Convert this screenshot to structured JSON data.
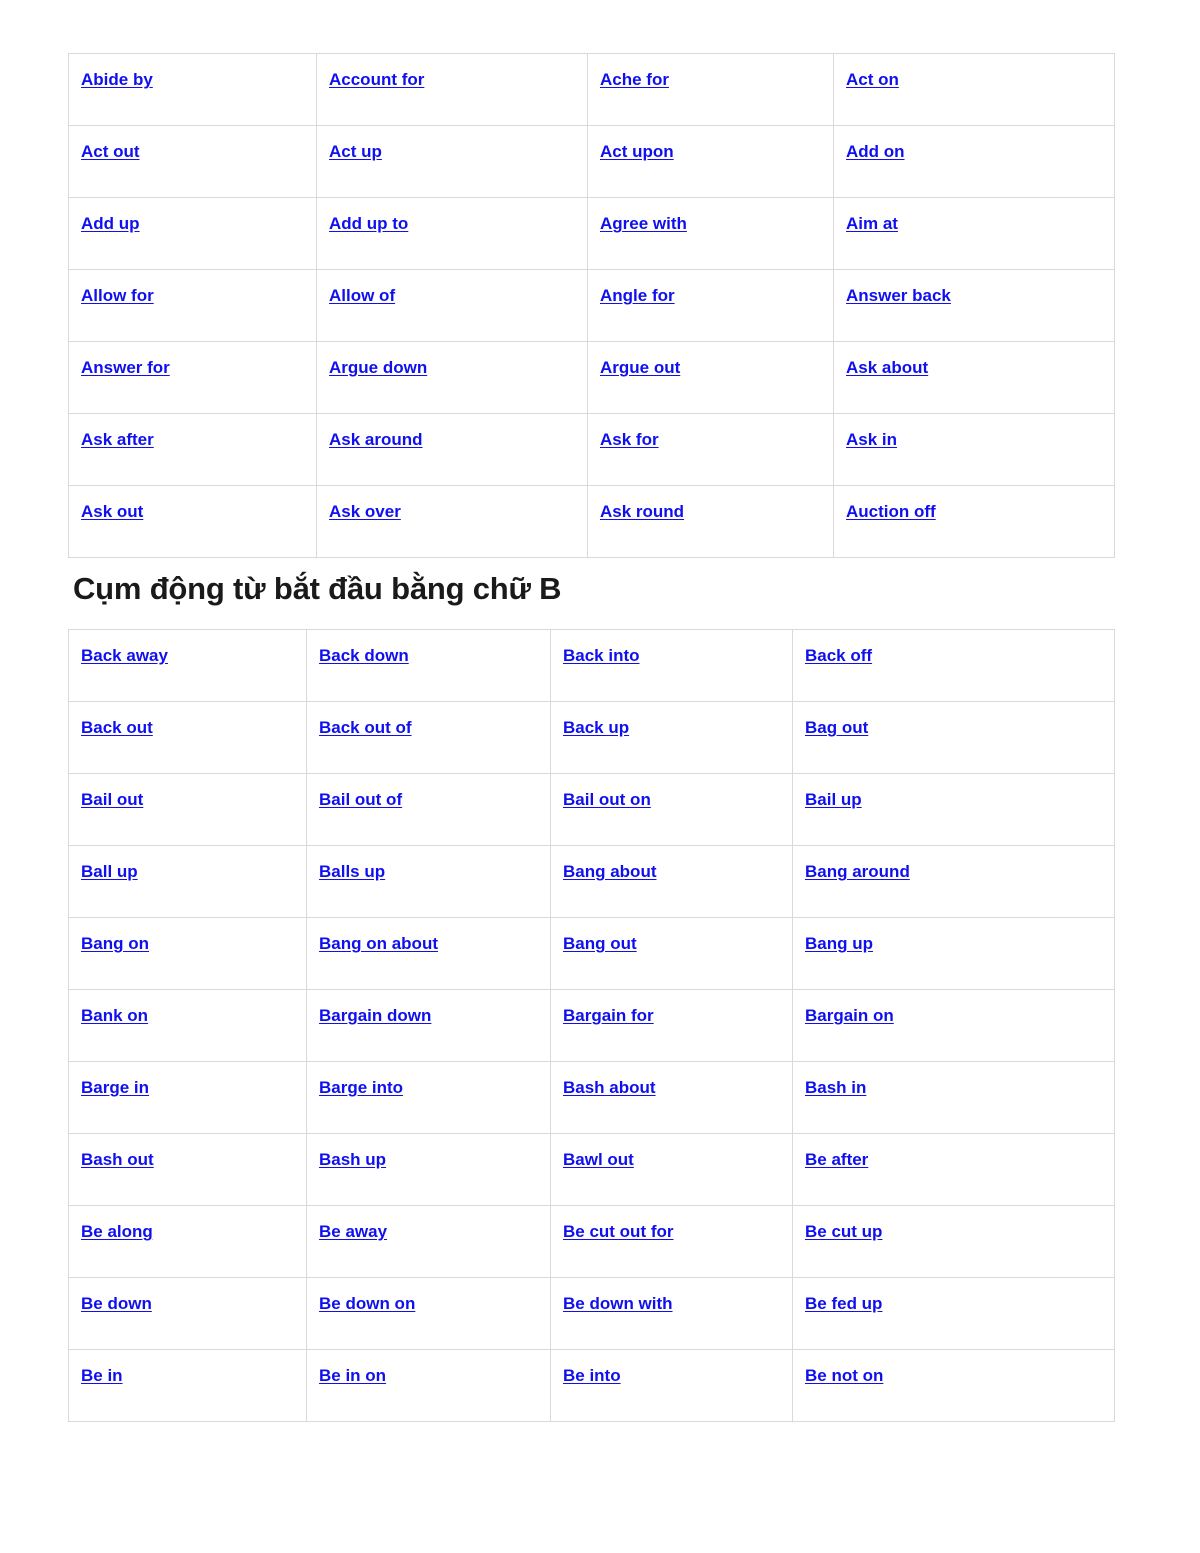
{
  "document": {
    "language": "vi",
    "link_color": "#1010ee",
    "border_color": "#d9d9d9",
    "background_color": "#ffffff",
    "heading_color": "#1a1a1a"
  },
  "sections": [
    {
      "id": "phrasal-verbs-a",
      "heading": null,
      "table": {
        "columns": 4,
        "rows": [
          [
            "Abide by",
            "Account for",
            "Ache for",
            "Act on"
          ],
          [
            "Act out",
            "Act up",
            "Act upon",
            "Add on"
          ],
          [
            "Add up",
            "Add up to",
            "Agree with",
            "Aim at"
          ],
          [
            "Allow for",
            "Allow of",
            "Angle for",
            "Answer back"
          ],
          [
            "Answer for",
            "Argue down",
            "Argue out",
            "Ask about"
          ],
          [
            "Ask after",
            "Ask around",
            "Ask for",
            "Ask in"
          ],
          [
            "Ask out",
            "Ask over",
            "Ask round",
            "Auction off"
          ]
        ]
      }
    },
    {
      "id": "phrasal-verbs-b",
      "heading": "Cụm động từ bắt đầu bằng chữ B",
      "table": {
        "columns": 4,
        "rows": [
          [
            "Back away",
            "Back down",
            "Back into",
            "Back off"
          ],
          [
            "Back out",
            "Back out of",
            "Back up",
            "Bag out"
          ],
          [
            "Bail out",
            "Bail out of",
            "Bail out on",
            "Bail up"
          ],
          [
            "Ball up",
            "Balls up",
            "Bang about",
            "Bang around"
          ],
          [
            "Bang on",
            "Bang on about",
            "Bang out",
            "Bang up"
          ],
          [
            "Bank on",
            "Bargain down",
            "Bargain for",
            "Bargain on"
          ],
          [
            "Barge in",
            "Barge into",
            "Bash about",
            "Bash in"
          ],
          [
            "Bash out",
            "Bash up",
            "Bawl out",
            "Be after"
          ],
          [
            "Be along",
            "Be away",
            "Be cut out for",
            "Be cut up"
          ],
          [
            "Be down",
            "Be down on",
            "Be down with",
            "Be fed up"
          ],
          [
            "Be in",
            "Be in on",
            "Be into",
            "Be not on"
          ]
        ]
      }
    }
  ]
}
